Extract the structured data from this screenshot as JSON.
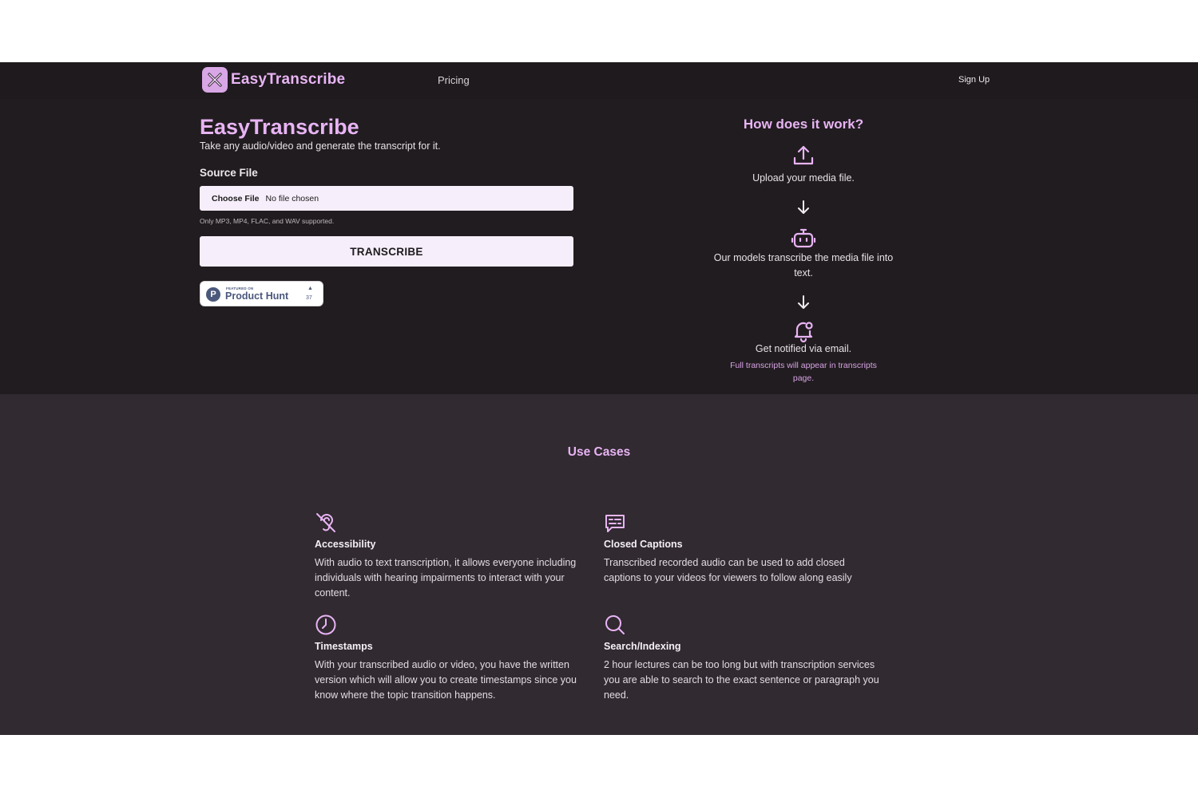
{
  "nav": {
    "brand": "EasyTranscribe",
    "pricing": "Pricing",
    "signup": "Sign Up"
  },
  "hero": {
    "title": "EasyTranscribe",
    "subtitle": "Take any audio/video and generate the transcript for it.",
    "source_label": "Source File",
    "file_button": "Choose File",
    "file_status": "No file chosen",
    "hint": "Only MP3, MP4, FLAC, and WAV supported.",
    "transcribe": "TRANSCRIBE",
    "producthunt": {
      "featured": "FEATURED ON",
      "name": "Product Hunt",
      "arrow": "▲",
      "votes": "37"
    }
  },
  "how": {
    "title": "How does it work?",
    "steps": [
      {
        "icon": "upload-icon",
        "text": "Upload your media file."
      },
      {
        "icon": "robot-icon",
        "text": "Our models transcribe the media file into text."
      },
      {
        "icon": "bell-icon",
        "text": "Get notified via email.",
        "note": "Full transcripts will appear in transcripts page."
      }
    ]
  },
  "use_cases": {
    "title": "Use Cases",
    "items": [
      {
        "icon": "ear-off-icon",
        "title": "Accessibility",
        "body": "With audio to text transcription, it allows everyone including individuals with hearing impairments to interact with your content."
      },
      {
        "icon": "captions-icon",
        "title": "Closed Captions",
        "body": "Transcribed recorded audio can be used to add closed captions to your videos for viewers to follow along easily"
      },
      {
        "icon": "clock-icon",
        "title": "Timestamps",
        "body": "With your transcribed audio or video, you have the written version which will allow you to create timestamps since you know where the topic transition happens."
      },
      {
        "icon": "search-icon",
        "title": "Search/Indexing",
        "body": "2 hour lectures can be too long but with transcription services you are able to search to the exact sentence or paragraph you need."
      }
    ]
  },
  "colors": {
    "accent": "#e8b4f4",
    "nav_bg": "#1e1a1d",
    "hero_bg": "#211c20",
    "uses_bg": "#312a31",
    "button_bg": "#f6eefa"
  }
}
